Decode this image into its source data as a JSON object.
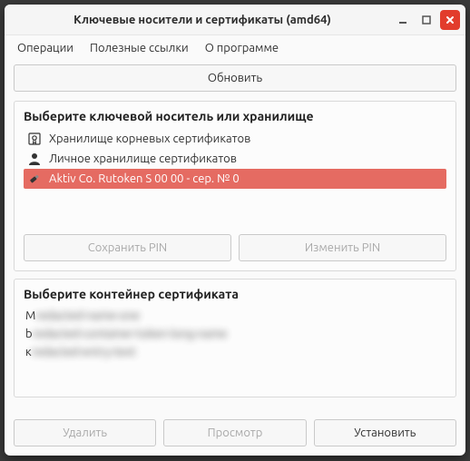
{
  "window": {
    "title": "Ключевые носители и сертификаты (amd64)"
  },
  "menu": {
    "operations": "Операции",
    "links": "Полезные ссылки",
    "about": "О программе"
  },
  "actions": {
    "refresh": "Обновить",
    "save_pin": "Сохранить PIN",
    "change_pin": "Изменить PIN",
    "delete": "Удалить",
    "view": "Просмотр",
    "install": "Установить"
  },
  "storage_panel": {
    "title": "Выберите ключевой носитель или хранилище",
    "items": [
      {
        "label": "Хранилище корневых сертификатов"
      },
      {
        "label": "Личное хранилище сертификатов"
      },
      {
        "label": "Aktiv Co. Rutoken S 00 00 - сер. № 0"
      }
    ]
  },
  "container_panel": {
    "title": "Выберите контейнер сертификата",
    "items": [
      {
        "prefix": "M",
        "rest": "redacted-name-one"
      },
      {
        "prefix": "b",
        "rest": "redacted-container-token-long-name"
      },
      {
        "prefix": "к",
        "rest": "redacted-entry-text"
      }
    ]
  }
}
